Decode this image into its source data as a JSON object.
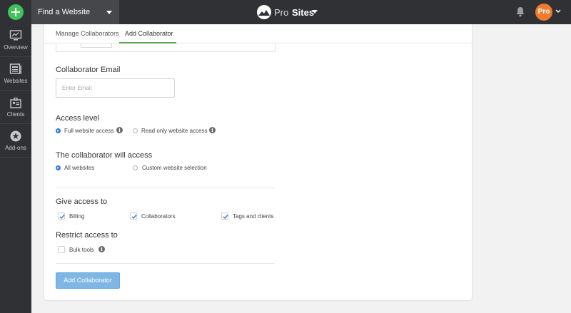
{
  "topbar": {
    "site_select_label": "Find a Website",
    "brand_word1": "Pro",
    "brand_word2": "Sites",
    "user_badge": "Pro"
  },
  "sidebar": {
    "items": [
      {
        "label": "Overview",
        "icon": "monitor-icon"
      },
      {
        "label": "Websites",
        "icon": "websites-icon"
      },
      {
        "label": "Clients",
        "icon": "clients-icon"
      },
      {
        "label": "Add-ons",
        "icon": "star-badge-icon"
      }
    ]
  },
  "tabs": [
    {
      "label": "Manage Collaborators",
      "active": false
    },
    {
      "label": "Add Collaborator",
      "active": true
    }
  ],
  "form": {
    "email_label": "Collaborator Email",
    "email_placeholder": "Enter Email",
    "email_value": "",
    "access_level_label": "Access level",
    "access_level_options": [
      {
        "label": "Full website access",
        "selected": true
      },
      {
        "label": "Read only website access",
        "selected": false
      }
    ],
    "will_access_label": "The collaborator will access",
    "will_access_options": [
      {
        "label": "All websites",
        "selected": true
      },
      {
        "label": "Custom website selection",
        "selected": false
      }
    ],
    "give_access_label": "Give access to",
    "give_access_items": [
      {
        "label": "Billing",
        "checked": true
      },
      {
        "label": "Collaborators",
        "checked": true
      },
      {
        "label": "Tags and clients",
        "checked": true
      }
    ],
    "restrict_label": "Restrict access to",
    "restrict_items": [
      {
        "label": "Bulk tools",
        "checked": false
      }
    ],
    "submit_label": "Add Collaborator"
  },
  "colors": {
    "topbar": "#2f3134",
    "accent_green": "#3ec45a",
    "tab_underline": "#5fa84e",
    "radio_blue": "#2d7bd8",
    "button_blue": "#7eb6e6",
    "pro_orange": "#f07a2d"
  }
}
